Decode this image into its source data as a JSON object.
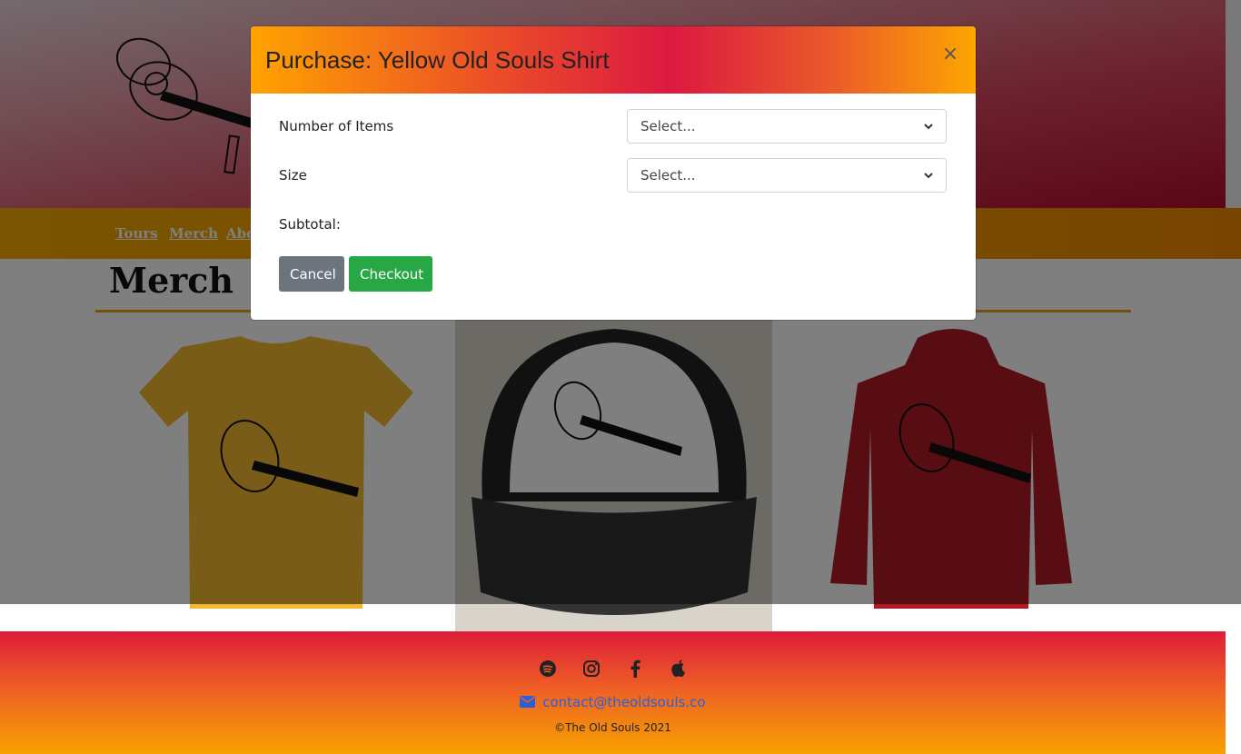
{
  "nav": {
    "items": [
      {
        "label": "Tours"
      },
      {
        "label": "Merch"
      },
      {
        "label": "Abo"
      }
    ]
  },
  "page": {
    "title": "Merch"
  },
  "products": [
    {
      "name": "yellow-shirt",
      "color": "#c99a24"
    },
    {
      "name": "trucker-cap",
      "color": "#2b2b2b"
    },
    {
      "name": "red-hoodie",
      "color": "#6e1318"
    }
  ],
  "modal": {
    "title": "Purchase: Yellow Old Souls Shirt",
    "close_label": "×",
    "fields": {
      "items_label": "Number of Items",
      "items_value": "Select...",
      "size_label": "Size",
      "size_value": "Select...",
      "subtotal_label": "Subtotal:"
    },
    "buttons": {
      "cancel": "Cancel",
      "checkout": "Checkout"
    }
  },
  "footer": {
    "icons": [
      "spotify-icon",
      "instagram-icon",
      "facebook-icon",
      "apple-icon"
    ],
    "email": "contact@theoldsouls.co",
    "copyright": "©The Old Souls 2021"
  },
  "colors": {
    "accent_orange": "#ffa300",
    "accent_red": "#dc1941",
    "checkout_green": "#28a745",
    "cancel_gray": "#6c757d",
    "link_blue": "#2a5fd8"
  }
}
